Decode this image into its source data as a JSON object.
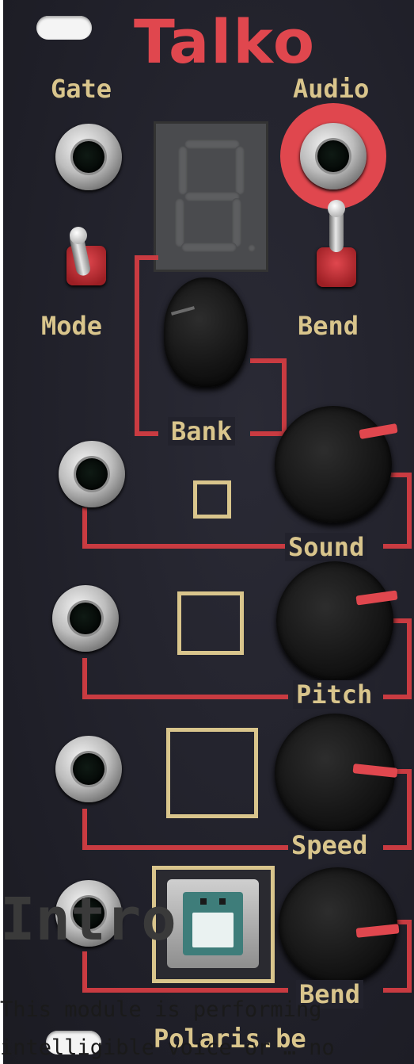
{
  "module": {
    "title": "Talko",
    "labels": {
      "gate": "Gate",
      "audio": "Audio",
      "mode": "Mode",
      "bend_top": "Bend",
      "bank": "Bank",
      "sound": "Sound",
      "pitch": "Pitch",
      "speed": "Speed",
      "bend_bottom": "Bend",
      "brand": "Polaris.be"
    },
    "display_digit": "8"
  },
  "overlay": {
    "heading": "Intro",
    "line1": "This module is performing",
    "line2": "intelligible voice or … no"
  },
  "colors": {
    "panel": "#22222c",
    "accent_red": "#e0474e",
    "label_gold": "#d9c58c"
  }
}
